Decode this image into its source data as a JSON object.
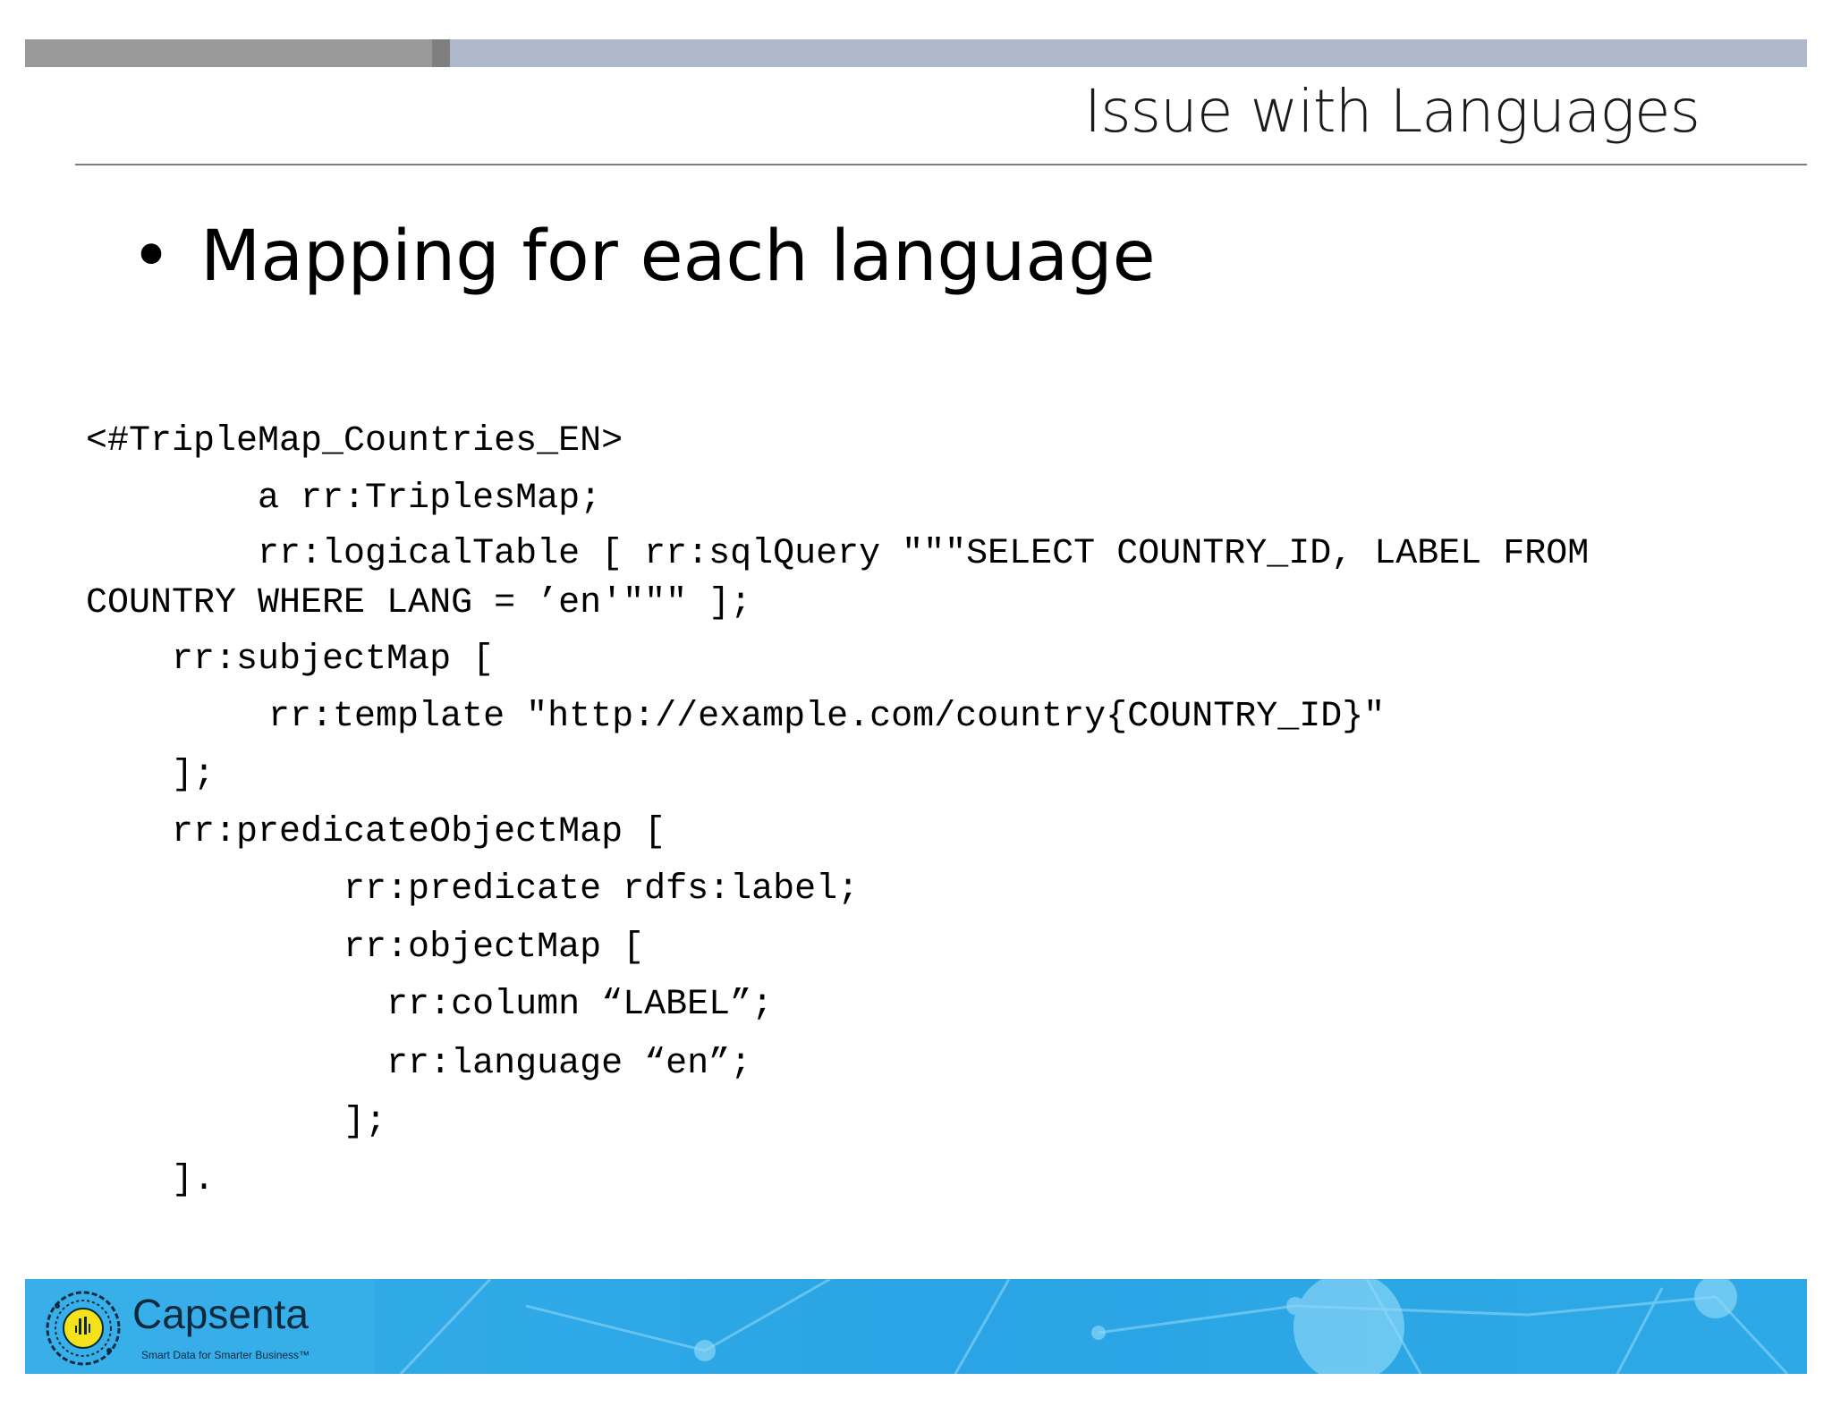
{
  "slide": {
    "title": "Issue with Languages",
    "bullet_symbol": "•",
    "bullet_text": "Mapping for each language"
  },
  "code": {
    "lines": [
      "<#TripleMap_Countries_EN>",
      "        a rr:TriplesMap;",
      "        rr:logicalTable [ rr:sqlQuery \"\"\"SELECT COUNTRY_ID, LABEL FROM",
      "COUNTRY WHERE LANG = ’en'\"\"\" ];",
      "    rr:subjectMap [",
      "        rr:template \"http://example.com/country{COUNTRY_ID}\"",
      "    ];",
      "    rr:predicateObjectMap [",
      "            rr:predicate rdfs:label;",
      "            rr:objectMap [",
      "              rr:column “LABEL”;",
      "              rr:language “en”;",
      "            ];",
      "    ]."
    ]
  },
  "footer": {
    "brand": "Capsenta",
    "tagline": "Smart Data for Smarter Business™",
    "colors": {
      "band": "#2aa6e6",
      "brand_text": "#0b2a3d",
      "logo_yellow": "#f5e21a"
    }
  },
  "colors": {
    "top_bar_gray": "#999999",
    "top_bar_blue": "#adb9ca",
    "title_rule": "#7f7f7f"
  }
}
